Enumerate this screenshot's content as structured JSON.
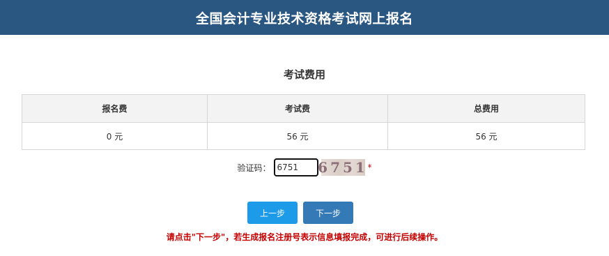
{
  "header": {
    "title": "全国会计专业技术资格考试网上报名"
  },
  "section": {
    "title": "考试费用"
  },
  "fees": {
    "columns": [
      "报名费",
      "考试费",
      "总费用"
    ],
    "values": [
      "0 元",
      "56 元",
      "56 元"
    ]
  },
  "captcha": {
    "label": "验证码：",
    "input_value": "6751",
    "image_text": "6751",
    "required_mark": "*"
  },
  "buttons": {
    "prev": "上一步",
    "next": "下一步"
  },
  "notice": "请点击\"下一步\"，若生成报名注册号表示信息填报完成，可进行后续操作。",
  "colors": {
    "header_bg": "#2a5782",
    "prev_button": "#1e9be8",
    "next_button": "#337ab7",
    "notice_text": "#c40000"
  }
}
